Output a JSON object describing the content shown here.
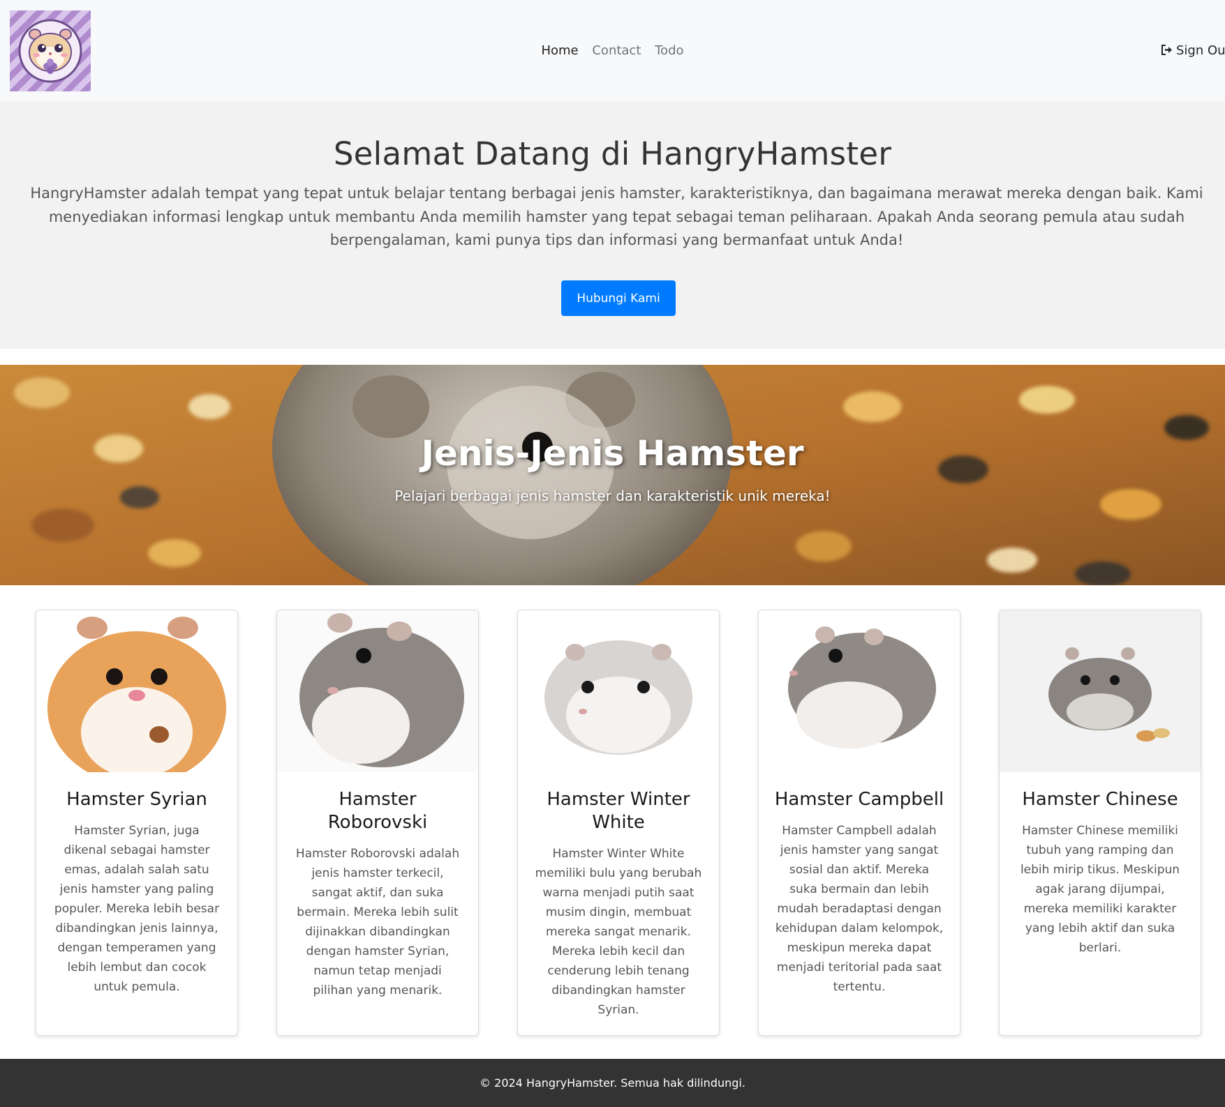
{
  "nav": {
    "links": [
      {
        "label": "Home"
      },
      {
        "label": "Contact"
      },
      {
        "label": "Todo"
      }
    ],
    "signout_label": "Sign Out"
  },
  "hero": {
    "title": "Selamat Datang di HangryHamster",
    "description": "HangryHamster adalah tempat yang tepat untuk belajar tentang berbagai jenis hamster, karakteristiknya, dan bagaimana merawat mereka dengan baik. Kami menyediakan informasi lengkap untuk membantu Anda memilih hamster yang tepat sebagai teman peliharaan. Apakah Anda seorang pemula atau sudah berpengalaman, kami punya tips dan informasi yang bermanfaat untuk Anda!",
    "button_label": "Hubungi Kami"
  },
  "banner": {
    "title": "Jenis-Jenis Hamster",
    "subtitle": "Pelajari berbagai jenis hamster dan karakteristik unik mereka!"
  },
  "cards": [
    {
      "title": "Hamster Syrian",
      "description": "Hamster Syrian, juga dikenal sebagai hamster emas, adalah salah satu jenis hamster yang paling populer. Mereka lebih besar dibandingkan jenis lainnya, dengan temperamen yang lebih lembut dan cocok untuk pemula."
    },
    {
      "title": "Hamster Roborovski",
      "description": "Hamster Roborovski adalah jenis hamster terkecil, sangat aktif, dan suka bermain. Mereka lebih sulit dijinakkan dibandingkan dengan hamster Syrian, namun tetap menjadi pilihan yang menarik."
    },
    {
      "title": "Hamster Winter White",
      "description": "Hamster Winter White memiliki bulu yang berubah warna menjadi putih saat musim dingin, membuat mereka sangat menarik. Mereka lebih kecil dan cenderung lebih tenang dibandingkan hamster Syrian."
    },
    {
      "title": "Hamster Campbell",
      "description": "Hamster Campbell adalah jenis hamster yang sangat sosial dan aktif. Mereka suka bermain dan lebih mudah beradaptasi dengan kehidupan dalam kelompok, meskipun mereka dapat menjadi teritorial pada saat tertentu."
    },
    {
      "title": "Hamster Chinese",
      "description": "Hamster Chinese memiliki tubuh yang ramping dan lebih mirip tikus. Meskipun agak jarang dijumpai, mereka memiliki karakter yang lebih aktif dan suka berlari."
    }
  ],
  "footer": {
    "text": "© 2024 HangryHamster. Semua hak dilindungi."
  },
  "colors": {
    "primary_button": "#007bff",
    "navbar_bg": "#f8f9fa",
    "hero_bg": "#f2f2f2",
    "footer_bg": "#333333"
  },
  "icons": {
    "logo": "hamster-logo-icon",
    "signout": "sign-out-icon"
  }
}
